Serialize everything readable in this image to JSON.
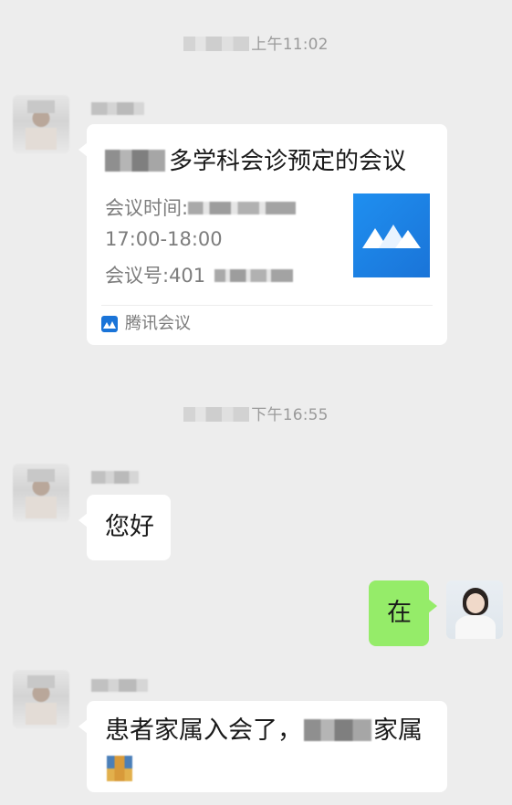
{
  "messages": {
    "ts1": {
      "time": "上午11:02"
    },
    "card": {
      "title_suffix": "多学科会诊预定的会议",
      "time_label": "会议时间:",
      "time_range": "17:00-18:00",
      "meeting_id_label": "会议号:401",
      "app_name": "腾讯会议"
    },
    "ts2": {
      "time": "下午16:55"
    },
    "greeting": {
      "text": "您好"
    },
    "reply": {
      "text": "在"
    },
    "last": {
      "text_before": "患者家属入会了，",
      "text_after": "家属"
    }
  },
  "colors": {
    "chat_background": "#ededed",
    "incoming_bubble": "#ffffff",
    "outgoing_bubble": "#95ec69",
    "tencent_meeting_blue": "#1a74d8"
  },
  "icons": {
    "meeting_thumbnail": "tencent-meeting-logo-icon",
    "footer_app": "tencent-meeting-small-icon"
  }
}
